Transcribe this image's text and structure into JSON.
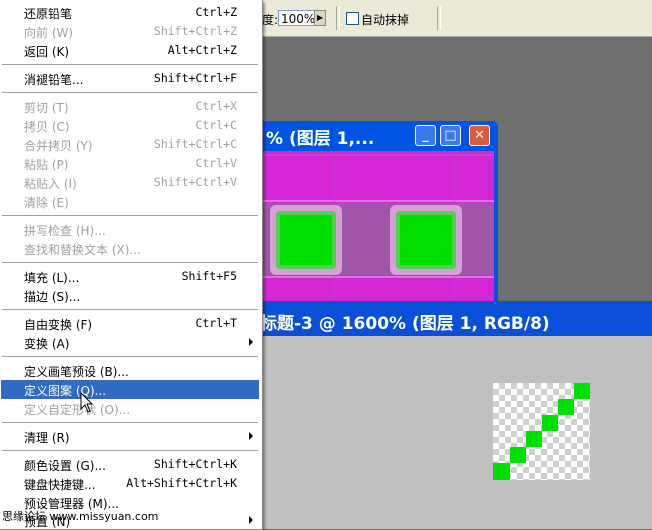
{
  "options_bar": {
    "opacity_label": "度:",
    "opacity_value": "100%",
    "auto_erase_label": "自动抹掉"
  },
  "window1": {
    "title": "% (图层 1,..."
  },
  "window2": {
    "title": "标题-3 @ 1600% (图层 1, RGB/8)"
  },
  "menu": {
    "items": [
      {
        "label": "还原铅笔",
        "shortcut": "Ctrl+Z",
        "disabled": false
      },
      {
        "label": "向前 (W)",
        "shortcut": "Shift+Ctrl+Z",
        "disabled": true
      },
      {
        "label": "返回 (K)",
        "shortcut": "Alt+Ctrl+Z",
        "disabled": false
      },
      {
        "label": "消褪铅笔...",
        "shortcut": "Shift+Ctrl+F",
        "disabled": false
      },
      {
        "label": "剪切 (T)",
        "shortcut": "Ctrl+X",
        "disabled": true
      },
      {
        "label": "拷贝 (C)",
        "shortcut": "Ctrl+C",
        "disabled": true
      },
      {
        "label": "合并拷贝 (Y)",
        "shortcut": "Shift+Ctrl+C",
        "disabled": true
      },
      {
        "label": "粘贴 (P)",
        "shortcut": "Ctrl+V",
        "disabled": true
      },
      {
        "label": "粘贴入 (I)",
        "shortcut": "Shift+Ctrl+V",
        "disabled": true
      },
      {
        "label": "清除 (E)",
        "shortcut": "",
        "disabled": true
      },
      {
        "label": "拼写检查 (H)...",
        "shortcut": "",
        "disabled": true
      },
      {
        "label": "查找和替换文本 (X)...",
        "shortcut": "",
        "disabled": true
      },
      {
        "label": "填充 (L)...",
        "shortcut": "Shift+F5",
        "disabled": false
      },
      {
        "label": "描边 (S)...",
        "shortcut": "",
        "disabled": false
      },
      {
        "label": "自由变换 (F)",
        "shortcut": "Ctrl+T",
        "disabled": false
      },
      {
        "label": "变换 (A)",
        "shortcut": "",
        "disabled": false,
        "submenu": true
      },
      {
        "label": "定义画笔预设 (B)...",
        "shortcut": "",
        "disabled": false
      },
      {
        "label": "定义图案 (Q)...",
        "shortcut": "",
        "disabled": false,
        "highlighted": true
      },
      {
        "label": "定义自定形状 (O)...",
        "shortcut": "",
        "disabled": true
      },
      {
        "label": "清理 (R)",
        "shortcut": "",
        "disabled": false,
        "submenu": true
      },
      {
        "label": "颜色设置 (G)...",
        "shortcut": "Shift+Ctrl+K",
        "disabled": false
      },
      {
        "label": "键盘快捷键...",
        "shortcut": "Alt+Shift+Ctrl+K",
        "disabled": false
      },
      {
        "label": "预设管理器 (M)...",
        "shortcut": "",
        "disabled": false
      },
      {
        "label": "预置 (N)",
        "shortcut": "",
        "disabled": false,
        "submenu": true
      }
    ]
  },
  "watermark": "思缘论坛 www.missyuan.com",
  "colors": {
    "menu_highlight": "#316ac5",
    "canvas_magenta": "#d426d4",
    "pattern_green": "#00e000",
    "titlebar_blue": "#0a4fd8"
  }
}
